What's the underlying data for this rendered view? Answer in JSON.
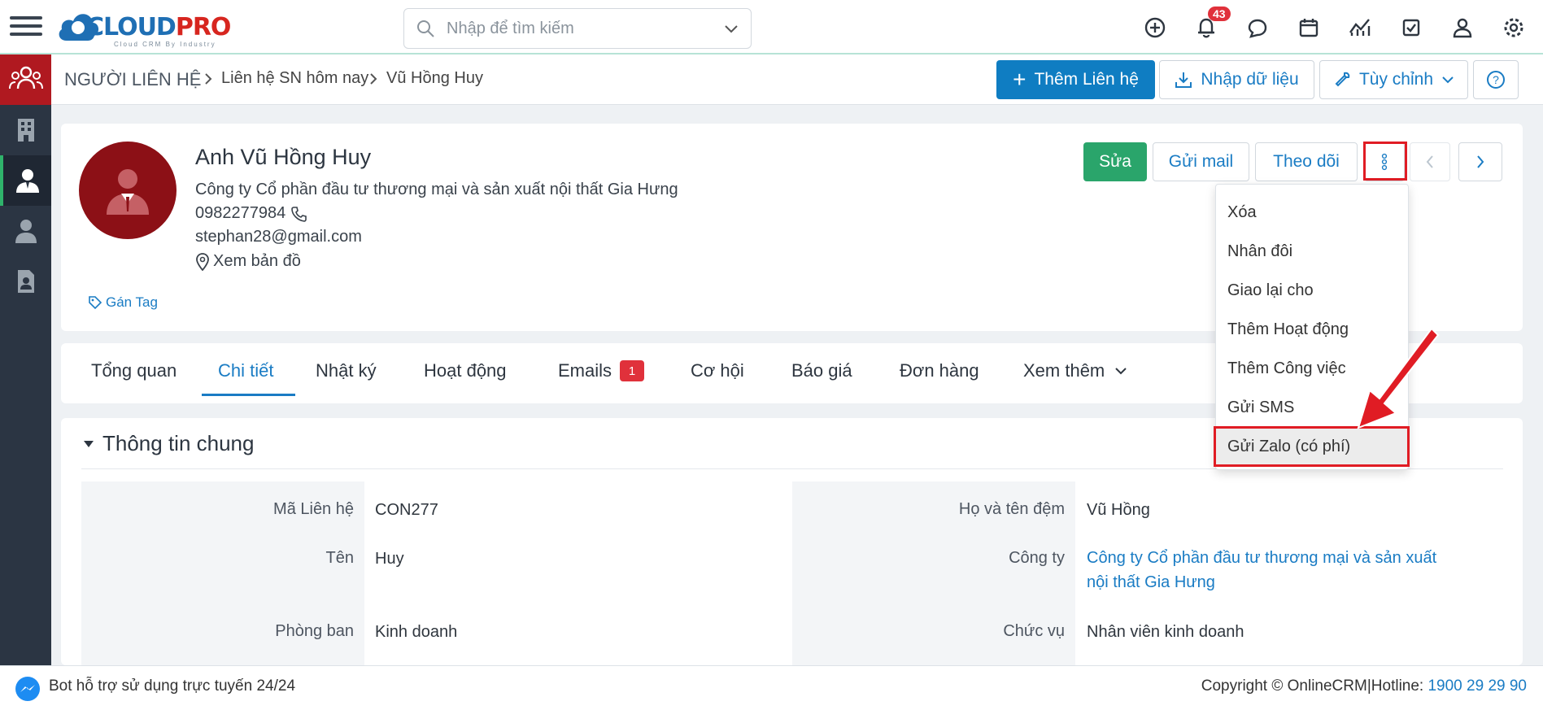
{
  "header": {
    "logo_text_a": "CLOUD",
    "logo_text_b": "PRO",
    "logo_sub": "Cloud CRM By Industry",
    "search_placeholder": "Nhập để tìm kiếm",
    "notification_count": "43"
  },
  "breadcrumb": {
    "module": "NGƯỜI LIÊN HỆ",
    "list": "Liên hệ SN hôm nay",
    "record": "Vũ Hồng Huy"
  },
  "toolbar": {
    "add_label": "Thêm Liên hệ",
    "import_label": "Nhập dữ liệu",
    "customize_label": "Tùy chỉnh"
  },
  "contact": {
    "name": "Anh Vũ Hồng Huy",
    "company": "Công ty Cổ phần đầu tư thương mại và sản xuất nội thất Gia Hưng",
    "phone": "0982277984",
    "email": "stephan28@gmail.com",
    "map_label": "Xem bản đồ",
    "tag_label": "Gán Tag"
  },
  "actions": {
    "edit": "Sửa",
    "send_mail": "Gửi mail",
    "follow": "Theo dõi"
  },
  "more_menu": [
    "Xóa",
    "Nhân đôi",
    "Giao lại cho",
    "Thêm Hoạt động",
    "Thêm Công việc",
    "Gửi SMS",
    "Gửi Zalo (có phí)"
  ],
  "tabs": {
    "overview": "Tổng quan",
    "detail": "Chi tiết",
    "log": "Nhật ký",
    "activity": "Hoạt động",
    "emails": "Emails",
    "emails_count": "1",
    "opportunity": "Cơ hội",
    "quote": "Báo giá",
    "order": "Đơn hàng",
    "more": "Xem thêm"
  },
  "section": {
    "title": "Thông tin chung",
    "fields": {
      "code_label": "Mã Liên hệ",
      "code_value": "CON277",
      "first_label": "Tên",
      "first_value": "Huy",
      "dept_label": "Phòng ban",
      "dept_value": "Kinh doanh",
      "last_label": "Họ và tên đệm",
      "last_value": "Vũ Hồng",
      "company_label": "Công ty",
      "company_value_1": "Công ty Cổ phần đầu tư thương mại và sản xuất",
      "company_value_2": "nội thất Gia Hưng",
      "title_label": "Chức vụ",
      "title_value": "Nhân viên kinh doanh"
    }
  },
  "footer": {
    "bot_text": "Bot hỗ trợ sử dụng trực tuyến 24/24",
    "copyright": "Copyright © OnlineCRM",
    "hotline_label": "|Hotline: ",
    "hotline": "1900 29 29 90"
  },
  "colors": {
    "primary": "#0f7dc2",
    "green": "#2aa56b",
    "sidebar": "#2b3543",
    "highlight": "#e01c24"
  }
}
